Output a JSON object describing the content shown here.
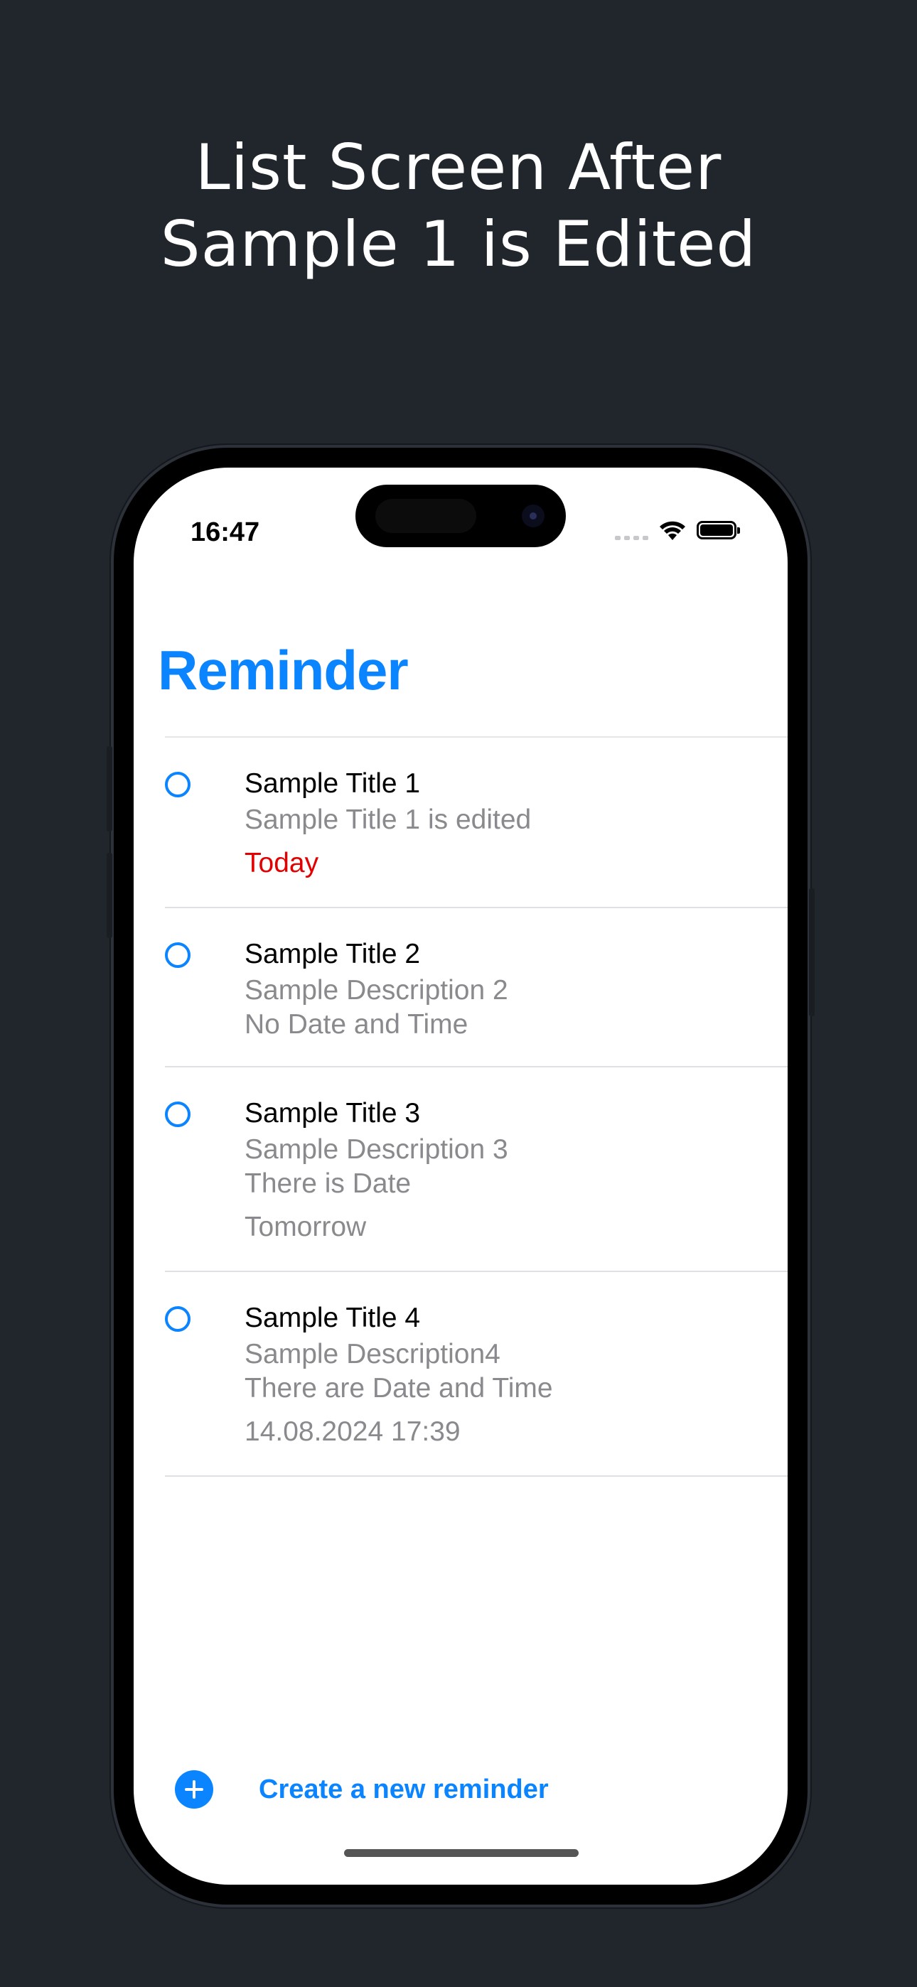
{
  "headline": {
    "line1": "List Screen After",
    "line2": "Sample 1 is Edited"
  },
  "status_bar": {
    "time": "16:47"
  },
  "nav": {
    "title": "Reminder"
  },
  "reminders": [
    {
      "title": "Sample Title 1",
      "description": "Sample Title 1 is edited",
      "extra": "",
      "date": "Today",
      "date_style": "today"
    },
    {
      "title": "Sample Title 2",
      "description": "Sample Description 2",
      "extra": "No Date and Time",
      "date": "",
      "date_style": "normal"
    },
    {
      "title": "Sample Title 3",
      "description": "Sample Description 3",
      "extra": "There is Date",
      "date": "Tomorrow",
      "date_style": "normal"
    },
    {
      "title": "Sample Title 4",
      "description": "Sample Description4",
      "extra": "There are Date and Time",
      "date": "14.08.2024 17:39",
      "date_style": "normal"
    }
  ],
  "toolbar": {
    "create_label": "Create a new reminder"
  },
  "colors": {
    "accent": "#0a84ff",
    "today": "#e30000",
    "secondary_text": "#8a8a8e",
    "background": "#21252c"
  },
  "icons": {
    "create": "plus-circle-icon",
    "complete": "circle-outline-icon",
    "wifi": "wifi-icon",
    "battery": "battery-icon",
    "signal": "cellular-signal-icon"
  }
}
